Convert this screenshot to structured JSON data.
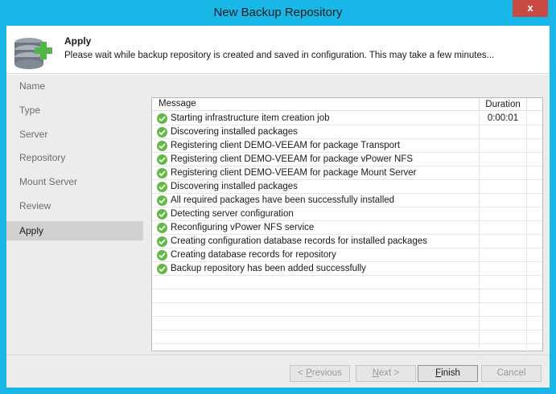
{
  "window": {
    "title": "New Backup Repository",
    "close_label": "x"
  },
  "header": {
    "title": "Apply",
    "description": "Please wait while backup repository is created and saved in configuration. This may take a few minutes...",
    "icon": "database-add-icon"
  },
  "steps": [
    {
      "label": "Name",
      "active": false
    },
    {
      "label": "Type",
      "active": false
    },
    {
      "label": "Server",
      "active": false
    },
    {
      "label": "Repository",
      "active": false
    },
    {
      "label": "Mount Server",
      "active": false
    },
    {
      "label": "Review",
      "active": false
    },
    {
      "label": "Apply",
      "active": true
    }
  ],
  "log": {
    "columns": {
      "message": "Message",
      "duration": "Duration"
    },
    "rows": [
      {
        "message": "Starting infrastructure item creation job",
        "duration": "0:00:01",
        "status": "success"
      },
      {
        "message": "Discovering installed packages",
        "duration": "",
        "status": "success"
      },
      {
        "message": "Registering client DEMO-VEEAM for package Transport",
        "duration": "",
        "status": "success"
      },
      {
        "message": "Registering client DEMO-VEEAM for package vPower NFS",
        "duration": "",
        "status": "success"
      },
      {
        "message": "Registering client DEMO-VEEAM for package Mount Server",
        "duration": "",
        "status": "success"
      },
      {
        "message": "Discovering installed packages",
        "duration": "",
        "status": "success"
      },
      {
        "message": "All required packages have been successfully installed",
        "duration": "",
        "status": "success"
      },
      {
        "message": "Detecting server configuration",
        "duration": "",
        "status": "success"
      },
      {
        "message": "Reconfiguring vPower NFS service",
        "duration": "",
        "status": "success"
      },
      {
        "message": "Creating configuration database records for installed packages",
        "duration": "",
        "status": "success"
      },
      {
        "message": "Creating database records for repository",
        "duration": "",
        "status": "success"
      },
      {
        "message": "Backup repository has been added successfully",
        "duration": "",
        "status": "success"
      }
    ],
    "empty_rows": 6
  },
  "buttons": {
    "previous": {
      "pre": "< ",
      "mn": "P",
      "post": "revious",
      "enabled": false
    },
    "next": {
      "pre": "",
      "mn": "N",
      "post": "ext >",
      "enabled": false
    },
    "finish": {
      "pre": "",
      "mn": "F",
      "post": "inish",
      "enabled": true
    },
    "cancel": {
      "pre": "",
      "mn": "",
      "post": "Cancel",
      "enabled": false
    }
  },
  "colors": {
    "title_bar": "#18b7e8",
    "close_button": "#c94a43",
    "success": "#64b946",
    "active_step": "#d1d1d1"
  }
}
